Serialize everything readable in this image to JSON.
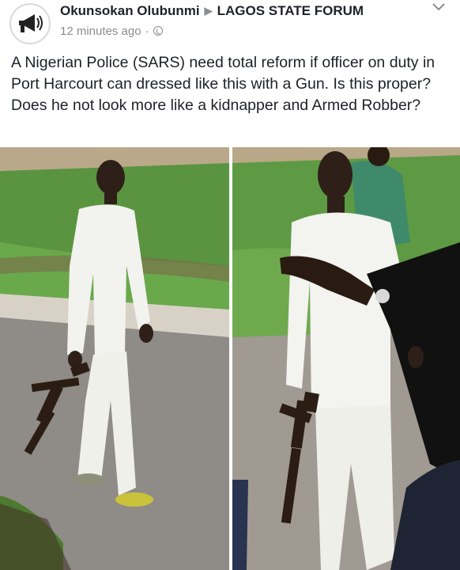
{
  "post": {
    "author": "Okunsokan Olubunmi",
    "group": "LAGOS STATE FORUM",
    "time": "12 minutes ago",
    "visibility_icon": "globe-icon",
    "text": "A Nigerian Police (SARS) need total reform if officer on duty in Port Harcourt can dressed like this with a Gun. Is this proper? Does he not look more like a kidnapper and Armed Robber?"
  },
  "avatar": {
    "logo_text": "Announcements"
  },
  "photos": [
    {
      "name": "photo-man-walking-with-gun"
    },
    {
      "name": "photo-man-standing-with-gun"
    }
  ],
  "colors": {
    "text": "#1d2129",
    "meta": "#8a8d91",
    "grass": "#4e8a3a",
    "road": "#9a9590",
    "clothing": "#f2f2ee"
  }
}
